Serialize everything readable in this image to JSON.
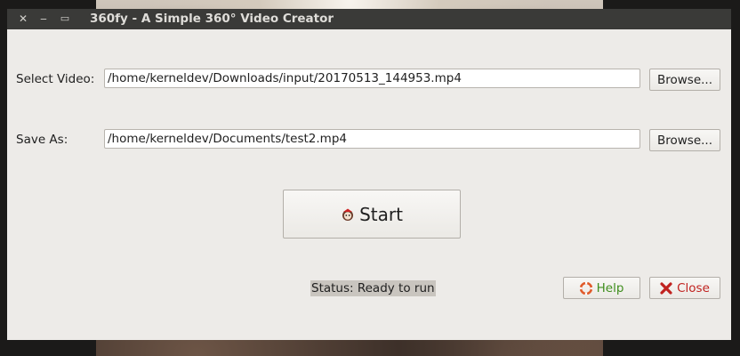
{
  "window": {
    "title": "360fy - A Simple 360° Video Creator",
    "controls": {
      "close_glyph": "✕",
      "minimize_glyph": "‒",
      "maximize_glyph": "▭"
    }
  },
  "form": {
    "video_label": "Select Video:",
    "video_value": "/home/kerneldev/Downloads/input/20170513_144953.mp4",
    "save_label": "Save As:",
    "save_value": "/home/kerneldev/Documents/test2.mp4",
    "browse_label": "Browse..."
  },
  "actions": {
    "start_label": "Start",
    "help_label": "Help",
    "close_label": "Close"
  },
  "status": {
    "text": "Status: Ready to run"
  },
  "icons": {
    "start": "start-app-icon",
    "help": "lifebuoy-icon",
    "close": "red-x-icon"
  },
  "colors": {
    "titlebar": "#3a3a38",
    "window_bg": "#edebe8",
    "help_text": "#3f8e1d",
    "close_text": "#c0221f",
    "lifebuoy": "#e05a2a",
    "status_bg": "#c9c5bf"
  }
}
